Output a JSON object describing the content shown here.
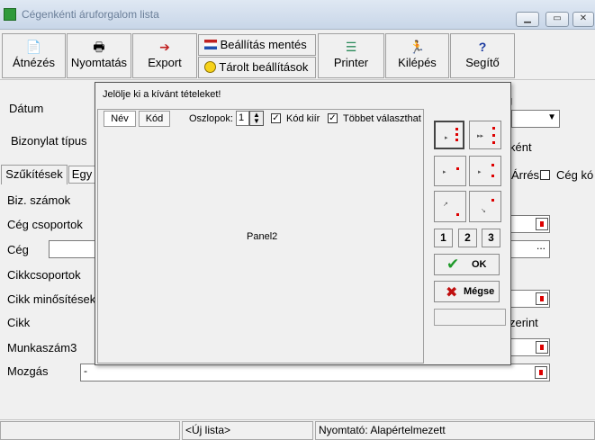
{
  "window": {
    "title": "Cégenkénti áruforgalom lista"
  },
  "toolbar": {
    "atnezes": "Átnézés",
    "nyomtatas": "Nyomtatás",
    "export": "Export",
    "beallitas_mentes": "Beállítás mentés",
    "tarolt_beallitasok": "Tárolt beállítások",
    "printer": "Printer",
    "kilepes": "Kilépés",
    "segito": "Segítő"
  },
  "form": {
    "datum": "Dátum",
    "bizonylat_tipus": "Bizonylat típus",
    "tab_szukitesek": "Szűkítések",
    "tab_egy": "Egy",
    "biz_szamok": "Biz. számok",
    "ceg_csoportok": "Cég csoportok",
    "ceg": "Cég",
    "cikkcsoportok": "Cikkcsoportok",
    "cikk_minositesek": "Cikk minősítések",
    "cikk": "Cikk",
    "munkaszam": "Munkaszám3",
    "mozgas": "Mozgás",
    "mozgas_value": "-",
    "right_g": "g",
    "right_kent": "ként",
    "right_arres": "Árrés",
    "right_ceg_ko": "Cég kó",
    "right_szerint": "zerint",
    "ellipsis": "..."
  },
  "dialog": {
    "title": "Jelölje ki a kívánt tételeket!",
    "tab_nev": "Név",
    "tab_kod": "Kód",
    "oszlopok_label": "Oszlopok:",
    "oszlopok_value": "1",
    "kod_kiir": "Kód kiír",
    "tobbet_valaszthat": "Többet választhat",
    "panel_label": "Panel2",
    "num1": "1",
    "num2": "2",
    "num3": "3",
    "ok": "OK",
    "megse": "Mégse"
  },
  "statusbar": {
    "uj_lista": "<Új lista>",
    "nyomtato": "Nyomtató: Alapértelmezett"
  },
  "colors": {
    "accent_red": "#d00000",
    "ok_green": "#1f9a2a",
    "cancel_red": "#c01010"
  }
}
